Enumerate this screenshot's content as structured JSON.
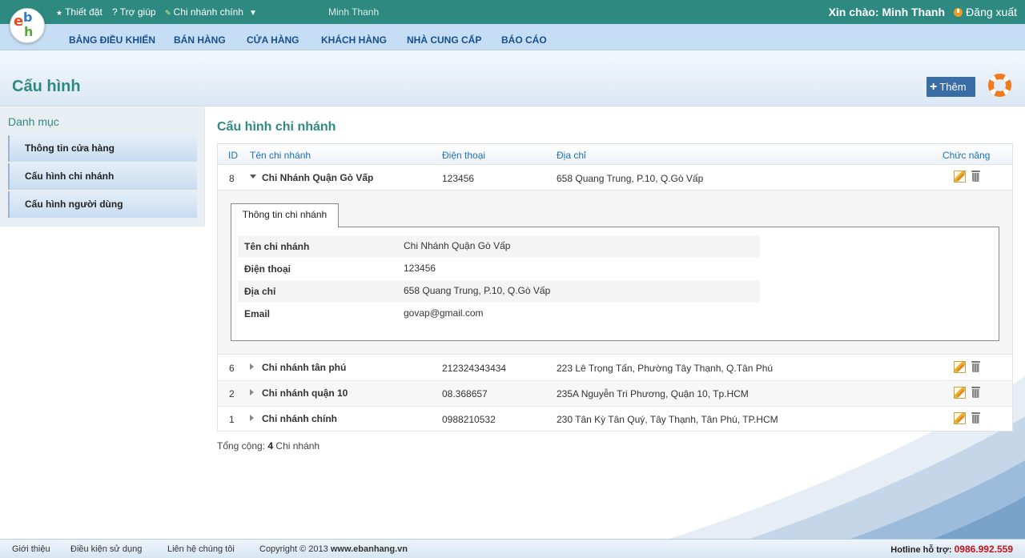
{
  "topbar": {
    "settings": "Thiết đặt",
    "help": "Trợ giúp",
    "branch": "Chi nhánh chính",
    "user_name": "Minh Thanh",
    "greeting": "Xin chào: Minh Thanh",
    "logout": "Đăng xuất"
  },
  "logo": {
    "e": "e",
    "b": "b",
    "h": "h"
  },
  "nav": [
    "BẢNG ĐIỀU KHIỂN",
    "BÁN HÀNG",
    "CỬA HÀNG",
    "KHÁCH HÀNG",
    "NHÀ CUNG CẤP",
    "BÁO CÁO"
  ],
  "page": {
    "title": "Cấu hình",
    "add_label": "Thêm",
    "add_icon": "plus-icon",
    "help_icon": "lifebuoy-icon"
  },
  "sidebar": {
    "title": "Danh mục",
    "items": [
      "Thông tin cửa hàng",
      "Cấu hình chi nhánh",
      "Cấu hình người dùng"
    ]
  },
  "main": {
    "title": "Cấu hình chi nhánh",
    "columns": {
      "id": "ID",
      "name": "Tên chi nhánh",
      "phone": "Điện thoại",
      "address": "Địa chỉ",
      "actions": "Chức năng"
    },
    "rows": [
      {
        "id": "8",
        "name": "Chi Nhánh Quận Gò Vấp",
        "phone": "123456",
        "address": "658 Quang Trung, P.10, Q.Gò Vấp",
        "expanded": true
      },
      {
        "id": "6",
        "name": "Chi nhánh tân phú",
        "phone": "212324343434",
        "address": "223 Lê Trọng Tấn, Phường Tây Thạnh, Q.Tân Phú",
        "expanded": false
      },
      {
        "id": "2",
        "name": "Chi nhánh quận 10",
        "phone": "08.368657",
        "address": "235A Nguyễn Tri Phương, Quận 10, Tp.HCM",
        "expanded": false
      },
      {
        "id": "1",
        "name": "Chi nhánh chính",
        "phone": "0988210532",
        "address": "230 Tân Kỳ Tân Quý, Tây Thạnh, Tân Phú, TP.HCM",
        "expanded": false
      }
    ],
    "detail": {
      "tab": "Thông tin chi nhánh",
      "fields": [
        {
          "label": "Tên chi nhánh",
          "value": "Chi Nhánh Quận Gò Vấp"
        },
        {
          "label": "Điện thoại",
          "value": "123456"
        },
        {
          "label": "Địa chỉ",
          "value": "658 Quang Trung, P.10, Q.Gò Vấp"
        },
        {
          "label": "Email",
          "value": "govap@gmail.com"
        }
      ]
    },
    "total": {
      "prefix": "Tổng cộng: ",
      "count": "4",
      "suffix": " Chi nhánh"
    }
  },
  "footer": {
    "links": [
      "Giới thiệu",
      "Điều kiện sử dụng",
      "Liên hệ chúng tôi"
    ],
    "copyright": "Copyright © 2013 ",
    "site": "www.ebanhang.vn",
    "hotline_label": "Hotline hỗ trợ: ",
    "hotline": "0986.992.559"
  },
  "colors": {
    "teal": "#2e8a80",
    "nav_bg": "#c6def5",
    "link_blue": "#1b70b8",
    "hotline_red": "#c0141b"
  }
}
